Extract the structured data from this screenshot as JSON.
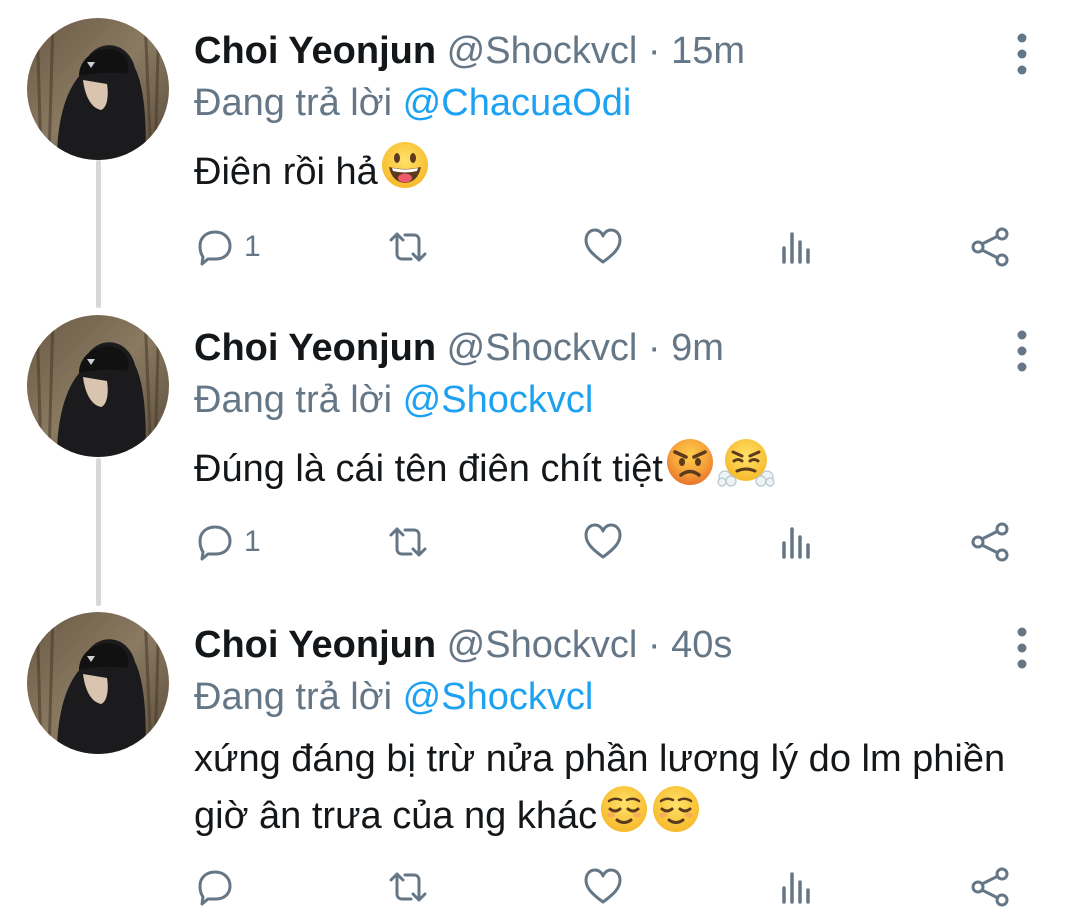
{
  "tweets": [
    {
      "name": "Choi Yeonjun",
      "handle": "@Shockvcl",
      "separator": "·",
      "time": "15m",
      "replying_prefix": "Đang trả lời",
      "replying_to": "@ChacuaOdi",
      "text": "Điên rồi hả",
      "emojis": [
        "grinning-face-with-tongue"
      ],
      "reply_count": "1"
    },
    {
      "name": "Choi Yeonjun",
      "handle": "@Shockvcl",
      "separator": "·",
      "time": "9m",
      "replying_prefix": "Đang trả lời",
      "replying_to": "@Shockvcl",
      "text": "Đúng là cái tên điên chít tiệt",
      "emojis": [
        "angry-face",
        "face-with-steam-from-nose"
      ],
      "reply_count": "1"
    },
    {
      "name": "Choi Yeonjun",
      "handle": "@Shockvcl",
      "separator": "·",
      "time": "40s",
      "replying_prefix": "Đang trả lời",
      "replying_to": "@Shockvcl",
      "text": "xứng đáng bị trừ nửa phần lương lý do lm phiền giờ ân trưa của ng khác",
      "emojis": [
        "relieved-face",
        "relieved-face"
      ],
      "reply_count": ""
    }
  ],
  "colors": {
    "text": "#14171a",
    "secondary": "#657786",
    "link": "#1da1f2",
    "thread_line": "#d6d9db"
  },
  "icons": [
    "reply-icon",
    "retweet-icon",
    "like-icon",
    "analytics-icon",
    "share-icon",
    "more-options-icon"
  ]
}
